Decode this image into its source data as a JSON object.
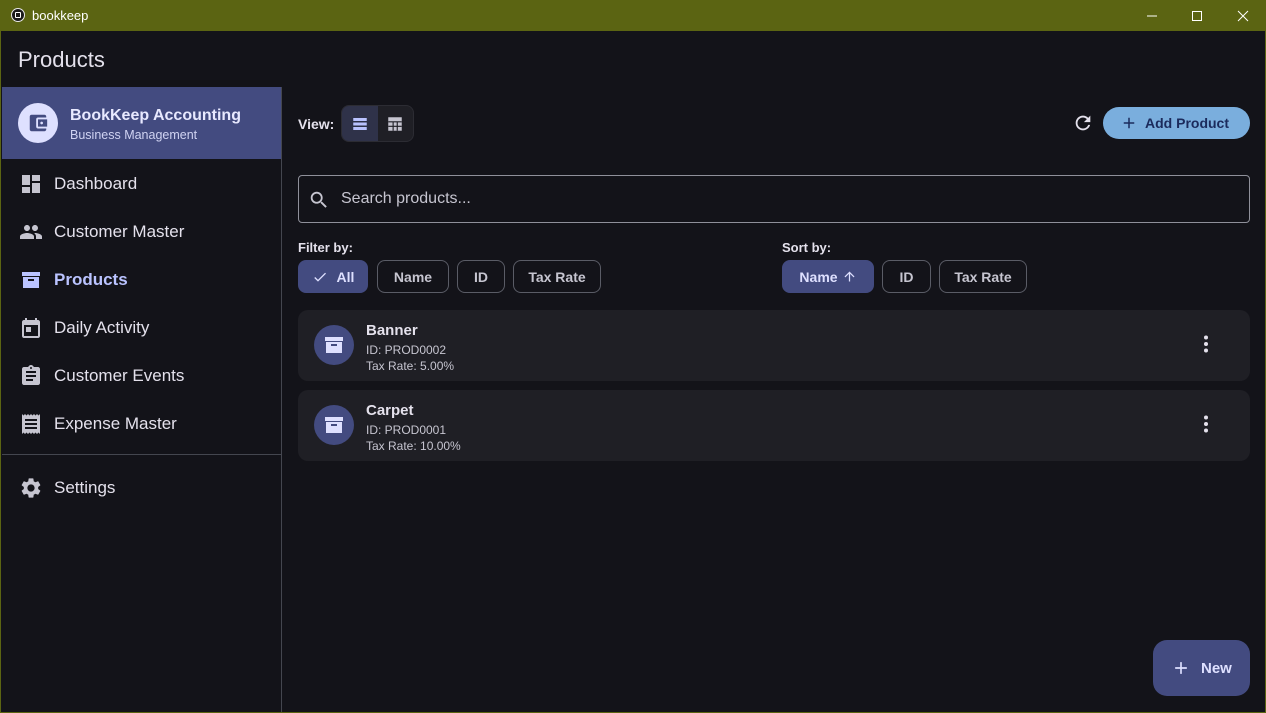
{
  "window": {
    "title": "bookkeep",
    "titlebar_color": "#5b6412"
  },
  "appbar": {
    "title": "Products"
  },
  "sidebar": {
    "org_name": "BookKeep Accounting",
    "org_subtitle": "Business Management",
    "items": [
      {
        "label": "Dashboard",
        "icon": "dashboard-icon"
      },
      {
        "label": "Customer Master",
        "icon": "people-icon"
      },
      {
        "label": "Products",
        "icon": "archive-icon",
        "active": true
      },
      {
        "label": "Daily Activity",
        "icon": "calendar-icon"
      },
      {
        "label": "Customer Events",
        "icon": "clipboard-icon"
      },
      {
        "label": "Expense Master",
        "icon": "receipt-icon"
      }
    ],
    "settings_label": "Settings"
  },
  "toolbar": {
    "view_label": "View:",
    "add_label": "Add Product"
  },
  "search": {
    "placeholder": "Search products..."
  },
  "filter": {
    "label": "Filter by:",
    "options": [
      "All",
      "Name",
      "ID",
      "Tax Rate"
    ],
    "selected": "All"
  },
  "sort": {
    "label": "Sort by:",
    "options": [
      "Name",
      "ID",
      "Tax Rate"
    ],
    "selected": "Name"
  },
  "products": [
    {
      "name": "Banner",
      "id_text": "ID: PROD0002",
      "tax_text": "Tax Rate: 5.00%"
    },
    {
      "name": "Carpet",
      "id_text": "ID: PROD0001",
      "tax_text": "Tax Rate: 10.00%"
    }
  ],
  "fab": {
    "label": "New"
  },
  "colors": {
    "accent": "#434b80",
    "primary_button": "#7aaedd",
    "active_nav_text": "#bac3ff"
  }
}
